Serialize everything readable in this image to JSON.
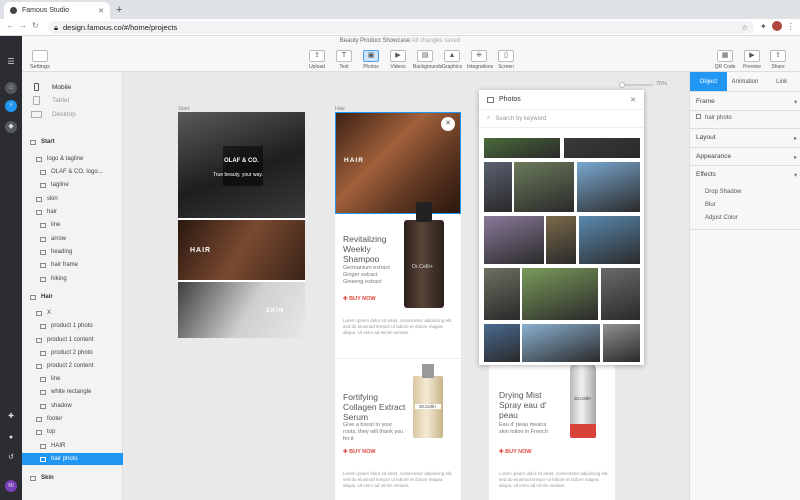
{
  "browser": {
    "tab_title": "Famous Studio",
    "url_host": "design.famous.co",
    "url_path": "/#/home/projects"
  },
  "toolbar": {
    "settings": "Settings",
    "doc_title": "Beauty Product Showcase",
    "saved": "All changes saved",
    "tools": [
      "Upload",
      "Text",
      "Photos",
      "Videos",
      "Backgrounds",
      "Graphics",
      "Integrations",
      "Screen"
    ],
    "right": [
      "QR Code",
      "Preview",
      "Share"
    ]
  },
  "devices": [
    "Mobile",
    "Tablet",
    "Desktop"
  ],
  "layers": [
    {
      "label": "Start",
      "kind": "sec"
    },
    {
      "label": "logo & tagline",
      "kind": "folder"
    },
    {
      "label": "OLAF & CO. logo...",
      "kind": "img"
    },
    {
      "label": "tagline",
      "kind": "text"
    },
    {
      "label": "skin",
      "kind": "folder"
    },
    {
      "label": "hair",
      "kind": "folder"
    },
    {
      "label": "line",
      "kind": "shape"
    },
    {
      "label": "arrow",
      "kind": "shape"
    },
    {
      "label": "heading",
      "kind": "text"
    },
    {
      "label": "hair frame",
      "kind": "img"
    },
    {
      "label": "hiking",
      "kind": "img"
    },
    {
      "label": "Hair",
      "kind": "sec"
    },
    {
      "label": "X",
      "kind": "folder"
    },
    {
      "label": "product 1 photo",
      "kind": "img"
    },
    {
      "label": "product 1 content",
      "kind": "folder"
    },
    {
      "label": "product 2 photo",
      "kind": "img"
    },
    {
      "label": "product 2 content",
      "kind": "folder"
    },
    {
      "label": "line",
      "kind": "shape"
    },
    {
      "label": "white rectangle",
      "kind": "shape"
    },
    {
      "label": "shadow",
      "kind": "shape"
    },
    {
      "label": "footer",
      "kind": "folder"
    },
    {
      "label": "top",
      "kind": "folder"
    },
    {
      "label": "HAIR",
      "kind": "text"
    },
    {
      "label": "hair photo",
      "kind": "img",
      "selected": true
    },
    {
      "label": "Skin",
      "kind": "sec"
    }
  ],
  "canvas": {
    "label_start": "Start",
    "label_hair": "Hair",
    "logo": "OLAF & CO.",
    "tagline": "True beauty, your way.",
    "hair": "HAIR",
    "skin": "SKIN",
    "p1_title": "Revitalizing Weekly Shampoo",
    "p1_ing": "Germanium extract\nGinger extract\nGinseng extract",
    "p2_title": "Fortifying Collagen Extract Serum",
    "p2_desc": "Give a boost to your roots, they will thank you for it",
    "p3_title": "Drying Mist Spray eau d' peau",
    "p3_desc": "Eau d' peau means skin lotion in French",
    "buy": "BUY NOW",
    "brand": "Dr.Celli+",
    "lorem": "Lorem ipsum dolor sit amet, consectetur adipiscing elit, sed do eiusmod tempor ut labore et dolore magna aliqua. Ut enim ad minim veniam.",
    "zoom": "75%"
  },
  "photos": {
    "title": "Photos",
    "placeholder": "Search by keyword"
  },
  "inspector": {
    "tabs": [
      "Object",
      "Animation",
      "Link"
    ],
    "frame": "Frame",
    "frame_item": "hair photo",
    "layout": "Layout",
    "appearance": "Appearance",
    "effects": "Effects",
    "effect_items": [
      "Drop Shadow",
      "Blur",
      "Adjust Color"
    ]
  },
  "user": {
    "initials": "MI"
  },
  "colors": {
    "accent": "#2196f3",
    "buy": "#e0473c",
    "rail": "#2b2d33"
  }
}
